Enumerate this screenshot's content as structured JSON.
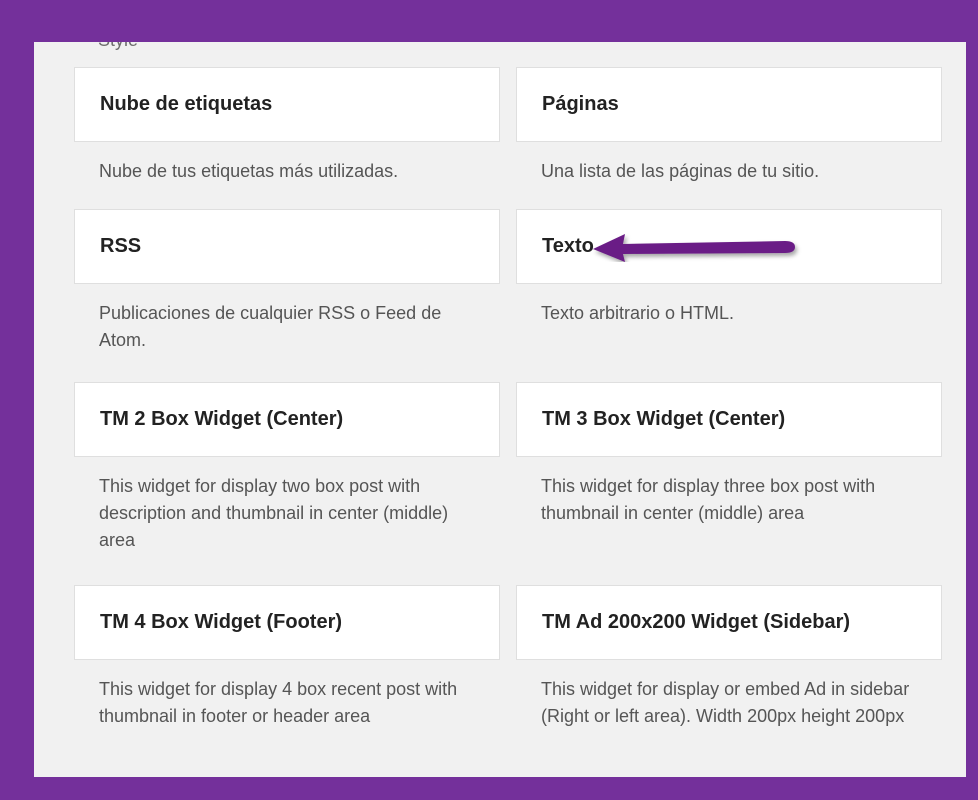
{
  "cut_label": "Style",
  "widgets": [
    {
      "title": "Nube de etiquetas",
      "description": "Nube de tus etiquetas más utilizadas."
    },
    {
      "title": "Páginas",
      "description": "Una lista de las páginas de tu sitio."
    },
    {
      "title": "RSS",
      "description": "Publicaciones de cualquier RSS o Feed de Atom."
    },
    {
      "title": "Texto",
      "description": "Texto arbitrario o HTML."
    },
    {
      "title": "TM 2 Box Widget (Center)",
      "description": "This widget for display two box post with description and thumbnail in center (middle) area"
    },
    {
      "title": "TM 3 Box Widget (Center)",
      "description": "This widget for display three box post with thumbnail in center (middle) area"
    },
    {
      "title": "TM 4 Box Widget (Footer)",
      "description": "This widget for display 4 box recent post with thumbnail in footer or header area"
    },
    {
      "title": "TM Ad 200x200 Widget (Sidebar)",
      "description": "This widget for display or embed Ad in sidebar (Right or left area). Width 200px height 200px"
    }
  ],
  "colors": {
    "frame": "#74309b",
    "panel": "#f1f1f1",
    "arrow": "#6a1f86"
  },
  "annotation": {
    "arrow_icon": "arrow-left-icon"
  }
}
